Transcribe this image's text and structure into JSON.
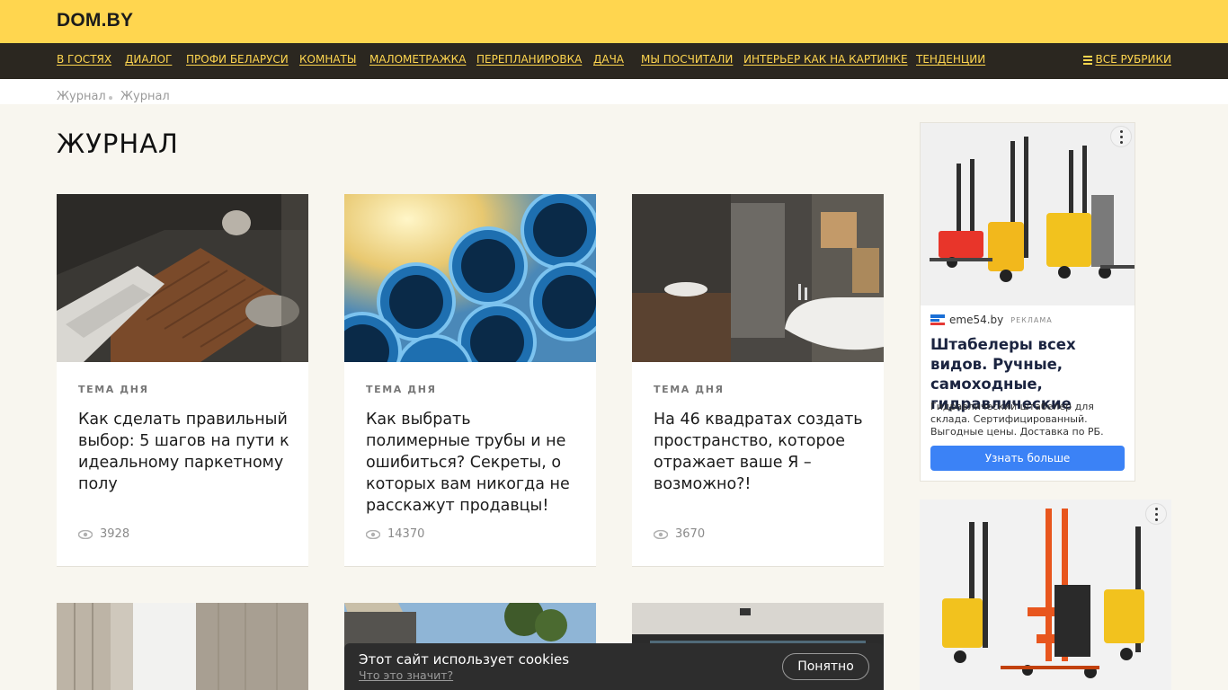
{
  "header": {
    "logo": "DOM.BY"
  },
  "nav": {
    "items": [
      "В ГОСТЯХ",
      "ДИАЛОГ",
      "ПРОФИ БЕЛАРУСИ",
      "КОМНАТЫ",
      "МАЛОМЕТРАЖКА",
      "ПЕРЕПЛАНИРОВКА",
      "ДАЧА",
      "МЫ ПОСЧИТАЛИ",
      "ИНТЕРЬЕР КАК НА КАРТИНКЕ",
      "ТЕНДЕНЦИИ"
    ],
    "all_rubrics": "ВСЕ РУБРИКИ"
  },
  "breadcrumb": [
    "Журнал",
    "Журнал"
  ],
  "page": {
    "title": "ЖУРНАЛ"
  },
  "articles": [
    {
      "tag": "ТЕМА ДНЯ",
      "title": "Как сделать правильный выбор: 5 шагов на пути к идеальному паркетному полу",
      "views": "3928"
    },
    {
      "tag": "ТЕМА ДНЯ",
      "title": "Как выбрать полимерные трубы и не ошибиться? Секреты, о которых вам никогда не расскажут продавцы!",
      "views": "14370"
    },
    {
      "tag": "ТЕМА ДНЯ",
      "title": "На 46 квадратах создать пространство, которое отражает ваше Я – возможно?!",
      "views": "3670"
    }
  ],
  "ad": {
    "source": "eme54.by",
    "label": "РЕКЛАМА",
    "headline": "Штабелеры всех видов. Ручные, самоходные, гидравлические",
    "description": "Гидравлический штабелер для склада. Сертифицированный. Выгодные цены. Доставка по РБ.",
    "button": "Узнать больше"
  },
  "cookie": {
    "text": "Этот сайт использует cookies",
    "link": "Что это значит?",
    "button": "Понятно"
  },
  "colors": {
    "brand_yellow": "#ffd64f",
    "nav_dark": "#2b2720",
    "background": "#f8f6ef",
    "ad_button": "#3b82f6"
  }
}
